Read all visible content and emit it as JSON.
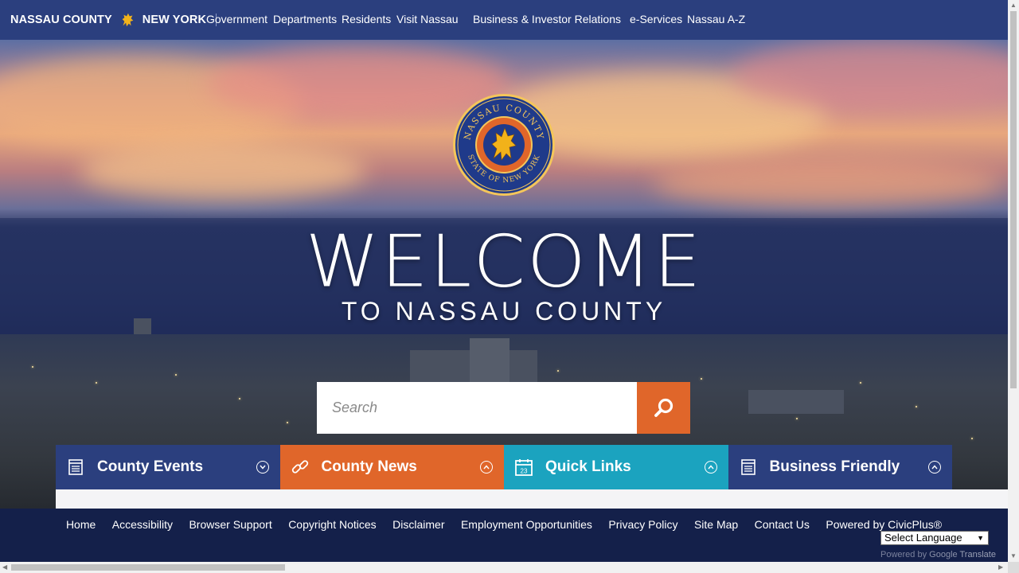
{
  "header": {
    "brand_left": "NASSAU COUNTY",
    "brand_right": "NEW YORK",
    "nav": [
      "Government",
      "Departments",
      "Residents",
      "Visit Nassau",
      "Business & Investor Relations",
      "e-Services",
      "Nassau A-Z"
    ]
  },
  "hero": {
    "welcome": "WELCOME",
    "subtitle": "TO NASSAU COUNTY",
    "seal_top_text": "NASSAU COUNTY",
    "seal_bottom_text": "STATE OF NEW YORK"
  },
  "search": {
    "placeholder": "Search"
  },
  "tiles": [
    {
      "label": "County Events",
      "color": "#2b3f7e",
      "icon": "calendar-list-icon"
    },
    {
      "label": "County News",
      "color": "#e0662a",
      "icon": "link-icon"
    },
    {
      "label": "Quick Links",
      "color": "#1ba3bf",
      "icon": "calendar-23-icon"
    },
    {
      "label": "Business Friendly",
      "color": "#2b3f7e",
      "icon": "document-icon"
    }
  ],
  "footer": {
    "links": [
      "Home",
      "Accessibility",
      "Browser Support",
      "Copyright Notices",
      "Disclaimer",
      "Employment Opportunities",
      "Privacy Policy",
      "Site Map",
      "Contact Us",
      "Powered by CivicPlus®"
    ],
    "language_select": "Select Language",
    "powered_by": "Powered by",
    "google": "Google",
    "translate": "Translate"
  },
  "colors": {
    "nav_bg": "#2b3f7e",
    "accent_orange": "#e0662a",
    "accent_teal": "#1ba3bf",
    "footer_bg": "#14204a"
  }
}
